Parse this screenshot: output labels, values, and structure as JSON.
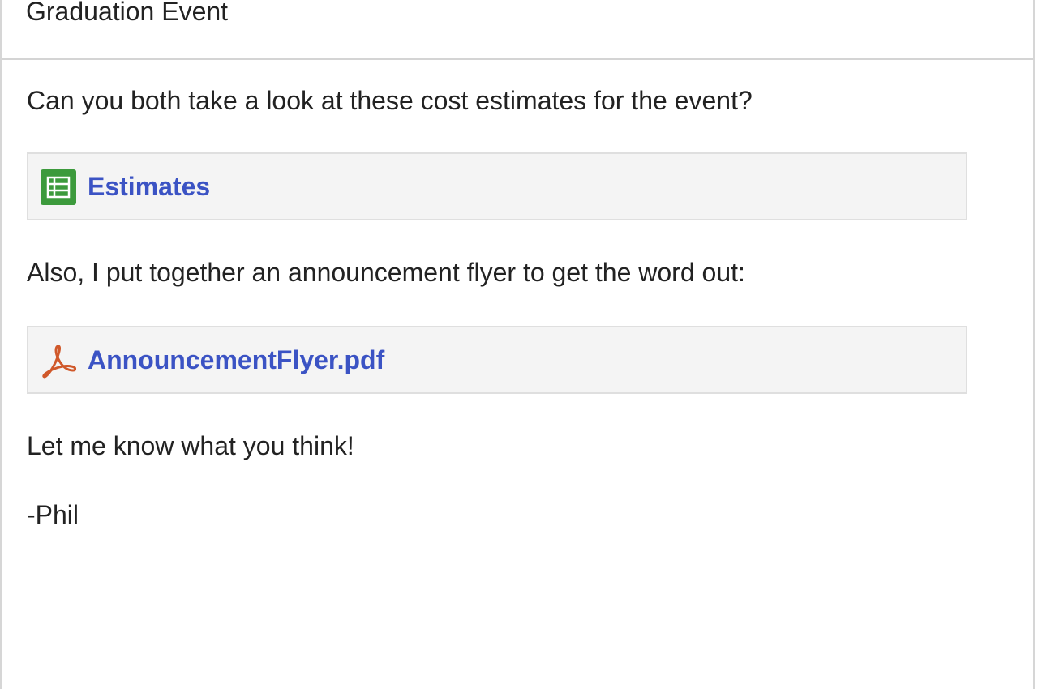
{
  "email": {
    "subject": "Graduation Event",
    "body": {
      "line1": "Can you both take a look at these cost estimates for the event?",
      "line2": "Also, I put together an announcement flyer to get the word out:",
      "line3": "Let me know what you think!",
      "signature": "-Phil"
    },
    "attachments": [
      {
        "name": "Estimates",
        "icon": "spreadsheet-icon",
        "icon_color": "#3c9a3c"
      },
      {
        "name": "AnnouncementFlyer.pdf",
        "icon": "pdf-icon",
        "icon_color": "#d0582a"
      }
    ]
  },
  "colors": {
    "link": "#3b53c4",
    "attachment_bg": "#f4f4f4",
    "text": "#222222"
  }
}
